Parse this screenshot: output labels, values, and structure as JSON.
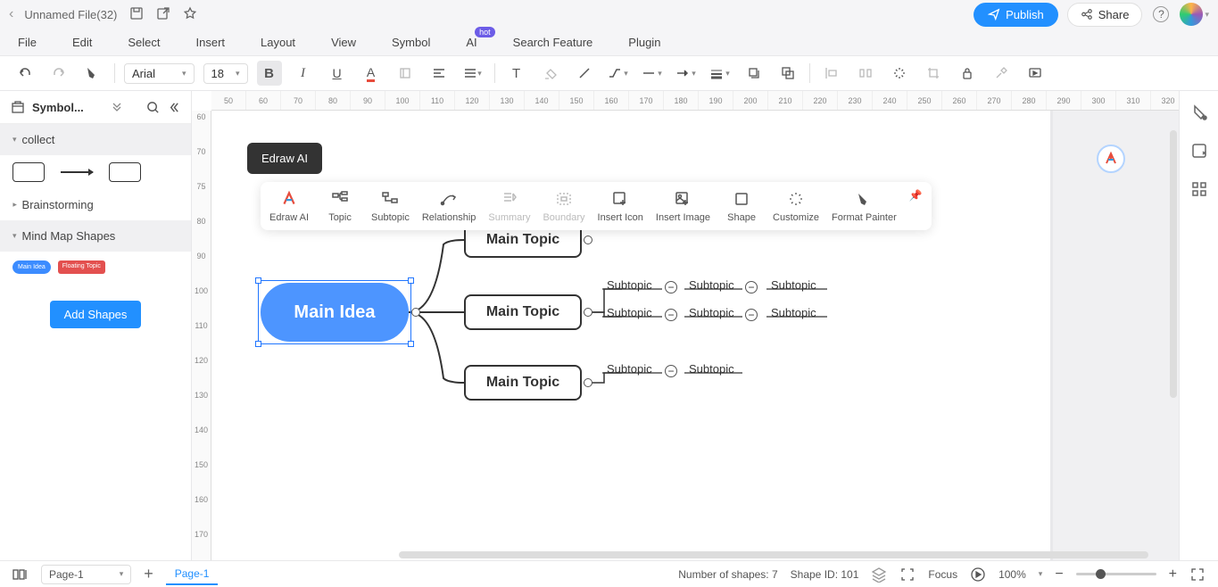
{
  "titleBar": {
    "filename": "Unnamed File(32)",
    "publish": "Publish",
    "share": "Share"
  },
  "menu": {
    "items": [
      "File",
      "Edit",
      "Select",
      "Insert",
      "Layout",
      "View",
      "Symbol",
      "AI",
      "Search Feature",
      "Plugin"
    ],
    "hotBadge": "hot"
  },
  "toolbar": {
    "font": "Arial",
    "size": "18"
  },
  "sidebar": {
    "title": "Symbol...",
    "groups": {
      "collect": "collect",
      "brainstorming": "Brainstorming",
      "mindmap": "Mind Map Shapes"
    },
    "mmShapes": {
      "main": "Main Idea",
      "floating": "Floating Topic"
    },
    "addShapes": "Add Shapes"
  },
  "tooltip": "Edraw AI",
  "floatToolbar": {
    "items": [
      {
        "label": "Edraw AI",
        "disabled": false
      },
      {
        "label": "Topic",
        "disabled": false
      },
      {
        "label": "Subtopic",
        "disabled": false
      },
      {
        "label": "Relationship",
        "disabled": false
      },
      {
        "label": "Summary",
        "disabled": true
      },
      {
        "label": "Boundary",
        "disabled": true
      },
      {
        "label": "Insert Icon",
        "disabled": false
      },
      {
        "label": "Insert Image",
        "disabled": false
      },
      {
        "label": "Shape",
        "disabled": false
      },
      {
        "label": "Customize",
        "disabled": false
      },
      {
        "label": "Format Painter",
        "disabled": false
      }
    ]
  },
  "mindmap": {
    "mainIdea": "Main Idea",
    "topics": [
      "Main Topic",
      "Main Topic",
      "Main Topic"
    ],
    "subtopics": {
      "t1_visible": "Main Topic",
      "row1": [
        "Subtopic",
        "Subtopic",
        "Subtopic"
      ],
      "row2": [
        "Subtopic",
        "Subtopic",
        "Subtopic"
      ],
      "row3": [
        "Subtopic",
        "Subtopic"
      ]
    }
  },
  "rulerH": [
    "50",
    "60",
    "70",
    "80",
    "90",
    "100",
    "110",
    "120",
    "130",
    "140",
    "150",
    "160",
    "170",
    "180",
    "190",
    "200",
    "210",
    "220",
    "230",
    "240",
    "250",
    "260",
    "270",
    "280",
    "290",
    "300",
    "310",
    "320"
  ],
  "rulerV": [
    "60",
    "70",
    "75",
    "80",
    "90",
    "100",
    "110",
    "120",
    "130",
    "140",
    "150",
    "160",
    "170"
  ],
  "status": {
    "pageSelect": "Page-1",
    "activeTab": "Page-1",
    "shapesCount": "Number of shapes: 7",
    "shapeId": "Shape ID: 101",
    "focus": "Focus",
    "zoom": "100%"
  }
}
